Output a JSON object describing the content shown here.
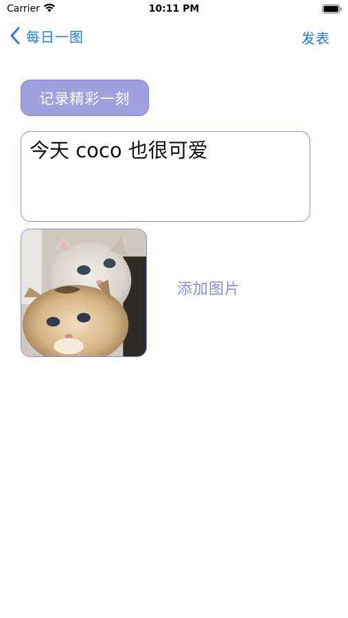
{
  "status_bar": {
    "carrier": "Carrier",
    "time": "10:11 PM",
    "wifi_icon": "wifi-icon",
    "battery_icon": "battery-icon"
  },
  "nav": {
    "back_icon": "chevron-left-icon",
    "back_label": "每日一图",
    "publish_label": "发表"
  },
  "content": {
    "tag_label": "记录精彩一刻",
    "post_text": "今天 coco 也很可爱",
    "photo": "kittens-photo",
    "add_photo_label": "添加图片"
  },
  "colors": {
    "accent_blue": "#1a7cf0",
    "purple": "#8f8bdc",
    "chip_fill": "#a3a0e0"
  }
}
